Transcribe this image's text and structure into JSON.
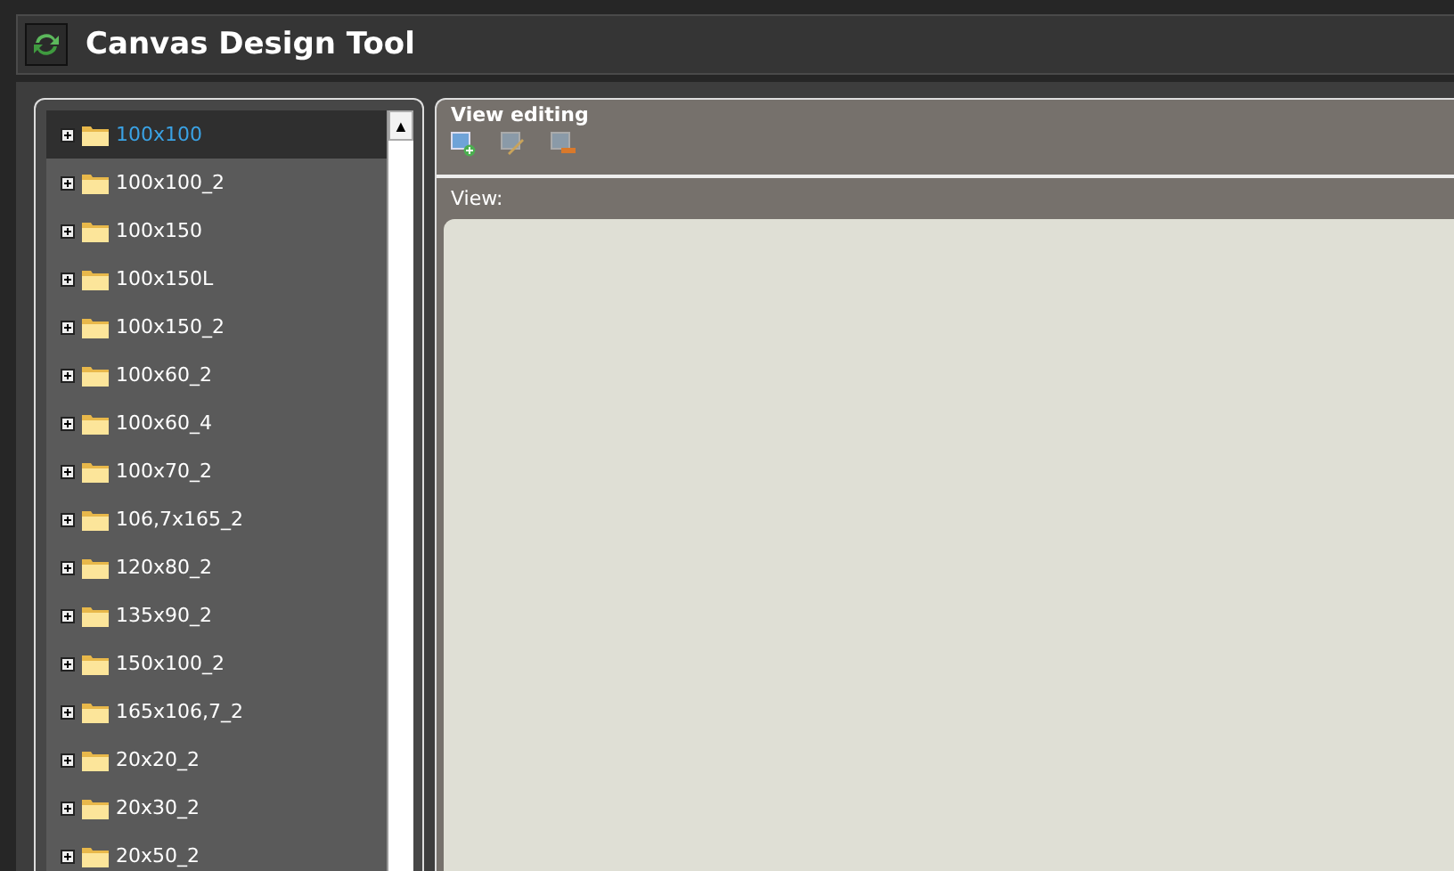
{
  "window": {
    "title": "Canvas Design Tool"
  },
  "tree": {
    "scroll_up": "▲",
    "items": [
      {
        "label": "100x100",
        "selected": true,
        "expanded": false
      },
      {
        "label": "100x100_2",
        "selected": false,
        "expanded": false
      },
      {
        "label": "100x150",
        "selected": false,
        "expanded": false
      },
      {
        "label": "100x150L",
        "selected": false,
        "expanded": false
      },
      {
        "label": "100x150_2",
        "selected": false,
        "expanded": false
      },
      {
        "label": "100x60_2",
        "selected": false,
        "expanded": false
      },
      {
        "label": "100x60_4",
        "selected": false,
        "expanded": false
      },
      {
        "label": "100x70_2",
        "selected": false,
        "expanded": false
      },
      {
        "label": "106,7x165_2",
        "selected": false,
        "expanded": false
      },
      {
        "label": "120x80_2",
        "selected": false,
        "expanded": false
      },
      {
        "label": "135x90_2",
        "selected": false,
        "expanded": false
      },
      {
        "label": "150x100_2",
        "selected": false,
        "expanded": false
      },
      {
        "label": "165x106,7_2",
        "selected": false,
        "expanded": false
      },
      {
        "label": "20x20_2",
        "selected": false,
        "expanded": false
      },
      {
        "label": "20x30_2",
        "selected": false,
        "expanded": false
      },
      {
        "label": "20x50_2",
        "selected": false,
        "expanded": false
      }
    ]
  },
  "editor": {
    "title": "View editing",
    "toolbar": [
      {
        "kind": "add"
      },
      {
        "kind": "edit"
      },
      {
        "kind": "delete"
      }
    ],
    "view_label": "View:"
  }
}
